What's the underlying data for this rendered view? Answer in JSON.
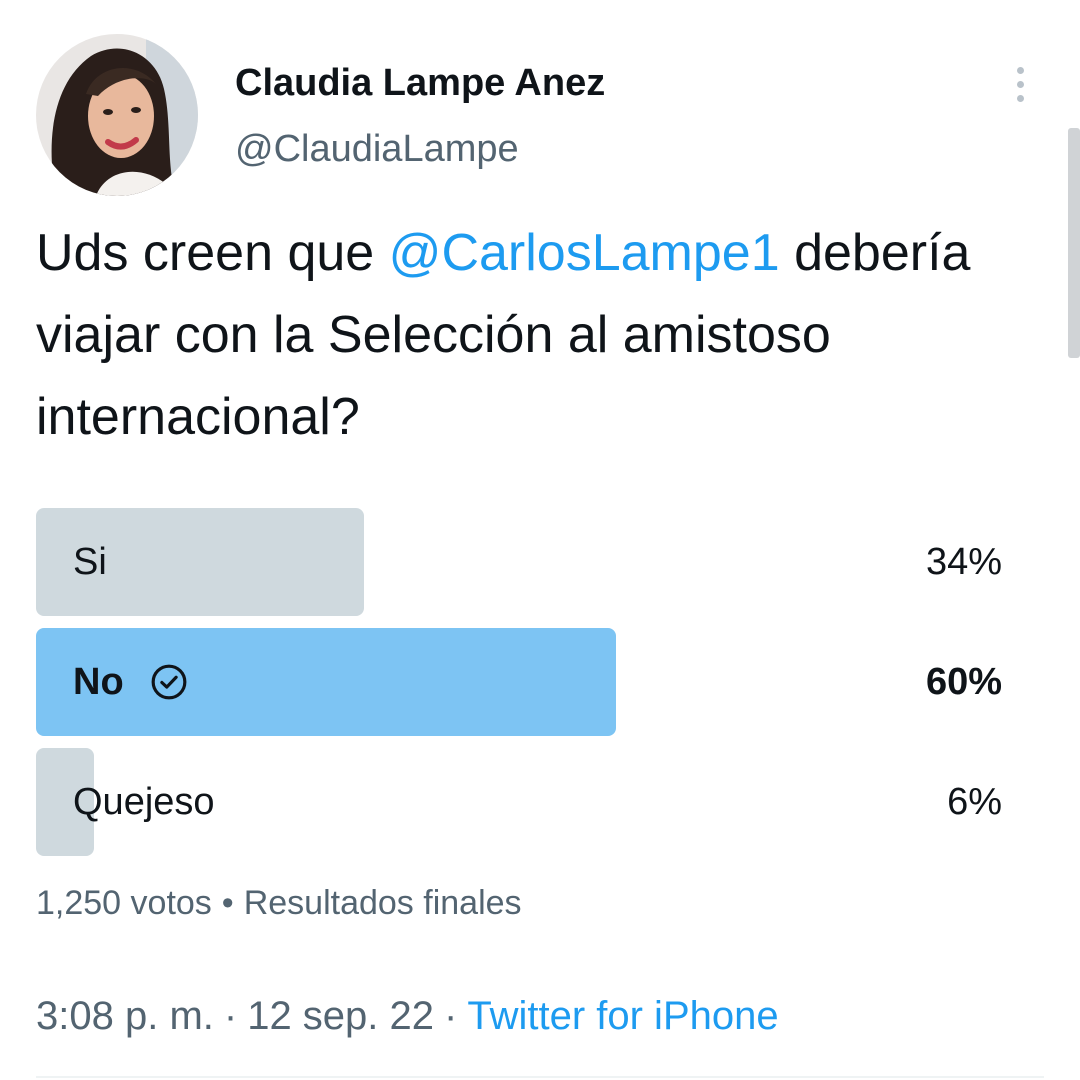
{
  "author": {
    "name": "Claudia Lampe Anez",
    "handle": "@ClaudiaLampe"
  },
  "tweet": {
    "text_before": "Uds creen que ",
    "mention": "@CarlosLampe1",
    "text_after": " debería viajar con la Selección al amistoso internacional?"
  },
  "poll": {
    "options": [
      {
        "label": "Si",
        "percent_text": "34%",
        "percent": 34,
        "winner": false
      },
      {
        "label": "No",
        "percent_text": "60%",
        "percent": 60,
        "winner": true
      },
      {
        "label": "Quejeso",
        "percent_text": "6%",
        "percent": 6,
        "winner": false
      }
    ],
    "votes": "1,250 votos",
    "separator": "•",
    "status": "Resultados finales"
  },
  "meta": {
    "time": "3:08 p. m.",
    "separator": "·",
    "date": "12 sep. 22",
    "source": "Twitter for iPhone"
  },
  "colors": {
    "accent": "#1d9bf0",
    "winner_bar": "#7dc4f3",
    "bar": "#cfd9de",
    "secondary_text": "#536471"
  },
  "icons": {
    "more": "more-vertical-icon",
    "winner": "check-circle-icon"
  }
}
